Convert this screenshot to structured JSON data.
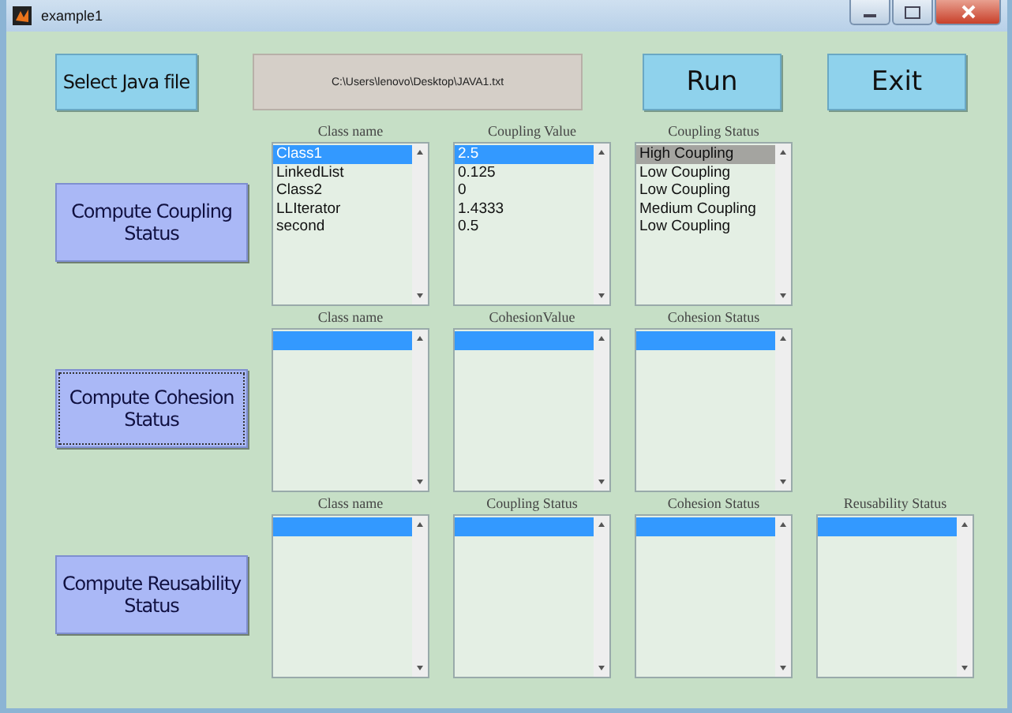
{
  "window": {
    "title": "example1"
  },
  "toolbar": {
    "select_button": "Select Java file",
    "file_path": "C:\\Users\\lenovo\\Desktop\\JAVA1.txt",
    "run_button": "Run",
    "exit_button": "Exit"
  },
  "sections": [
    {
      "button": "Compute Coupling Status",
      "button_focused": false,
      "lists": [
        {
          "heading": "Class name",
          "focused": true,
          "items": [
            {
              "text": "Class1",
              "selected": true
            },
            {
              "text": "LinkedList",
              "selected": false
            },
            {
              "text": "Class2",
              "selected": false
            },
            {
              "text": "LLIterator",
              "selected": false
            },
            {
              "text": "second",
              "selected": false
            }
          ]
        },
        {
          "heading": "Coupling Value",
          "focused": true,
          "items": [
            {
              "text": "2.5",
              "selected": true
            },
            {
              "text": "0.125",
              "selected": false
            },
            {
              "text": "0",
              "selected": false
            },
            {
              "text": "1.4333",
              "selected": false
            },
            {
              "text": "0.5",
              "selected": false
            }
          ]
        },
        {
          "heading": "Coupling Status",
          "focused": false,
          "items": [
            {
              "text": "High Coupling",
              "selected": true
            },
            {
              "text": "Low Coupling",
              "selected": false
            },
            {
              "text": "Low Coupling",
              "selected": false
            },
            {
              "text": "Medium Coupling",
              "selected": false
            },
            {
              "text": "Low Coupling",
              "selected": false
            }
          ]
        }
      ]
    },
    {
      "button": "Compute Cohesion Status",
      "button_focused": true,
      "lists": [
        {
          "heading": "Class name",
          "focused": true,
          "selection_bar": true
        },
        {
          "heading": "CohesionValue",
          "focused": true,
          "selection_bar": true
        },
        {
          "heading": "Cohesion Status",
          "focused": true,
          "selection_bar": true
        }
      ]
    },
    {
      "button": "Compute Reusability Status",
      "button_focused": false,
      "lists": [
        {
          "heading": "Class name",
          "focused": true,
          "selection_bar": true
        },
        {
          "heading": "Coupling Status",
          "focused": true,
          "selection_bar": true
        },
        {
          "heading": "Cohesion Status",
          "focused": true,
          "selection_bar": true
        },
        {
          "heading": "Reusability Status",
          "focused": true,
          "selection_bar": true
        }
      ]
    }
  ]
}
